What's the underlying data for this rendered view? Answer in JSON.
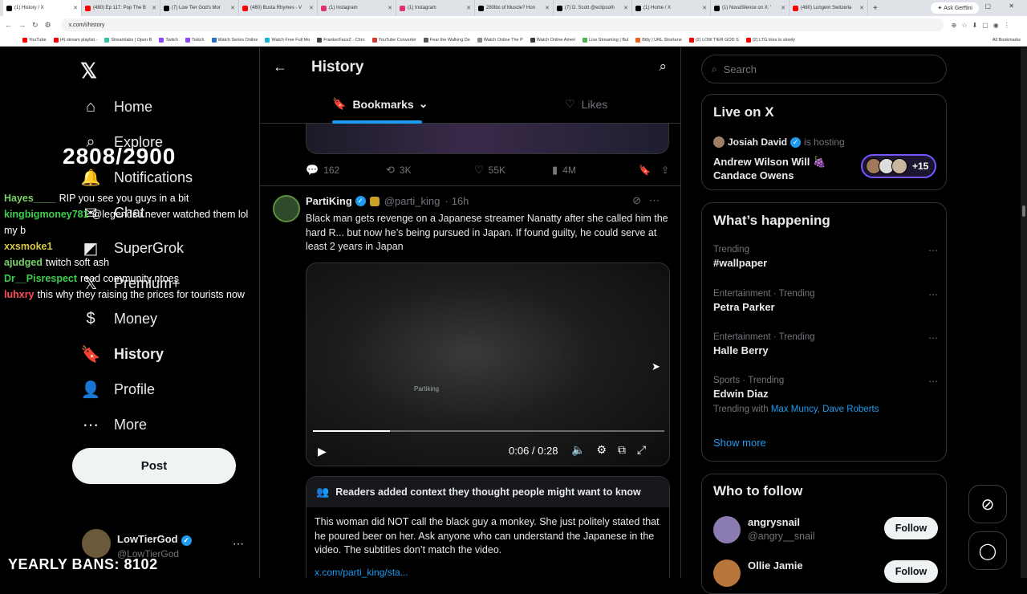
{
  "browser": {
    "tabs": [
      {
        "label": "(1) History / X",
        "color": "#000000",
        "active": true
      },
      {
        "label": "(480) Ep 117: Pop The B",
        "color": "#ff0000"
      },
      {
        "label": "(7) Low Tier God's Mor",
        "color": "#000000"
      },
      {
        "label": "(480) Busta Rhymes - V",
        "color": "#ff0000"
      },
      {
        "label": "(1) Instagram",
        "color": "#e1306c"
      },
      {
        "label": "(1) Instagram",
        "color": "#e1306c"
      },
      {
        "label": "280lbs of Muscle? Hon",
        "color": "#000000"
      },
      {
        "label": "(7) D. Scott @eclipsoth",
        "color": "#000000"
      },
      {
        "label": "(1) Home / X",
        "color": "#000000"
      },
      {
        "label": "(1) NovaSilence on X: '",
        "color": "#000000"
      },
      {
        "label": "(480) Lungem Switzerla",
        "color": "#ff0000"
      }
    ],
    "ask_gemini": "Ask Gemini",
    "url": "x.com/i/history",
    "bookmarks": [
      {
        "label": "YouTube",
        "color": "#ff0000"
      },
      {
        "label": "(4) stream playlist -",
        "color": "#ff0000"
      },
      {
        "label": "Streamlabs | Open B",
        "color": "#31c3a2"
      },
      {
        "label": "Twitch",
        "color": "#9146ff"
      },
      {
        "label": "Twitch",
        "color": "#9146ff"
      },
      {
        "label": "Watch Series Online",
        "color": "#2a6ebb"
      },
      {
        "label": "Watch Free Full Mo",
        "color": "#19b5d1"
      },
      {
        "label": "FrankerFaceZ - Chro",
        "color": "#444444"
      },
      {
        "label": "YouTube Converter",
        "color": "#d23a3a"
      },
      {
        "label": "Fear the Walking De",
        "color": "#5a5a5a"
      },
      {
        "label": "Watch Online The P",
        "color": "#888888"
      },
      {
        "label": "Watch Online Ameri",
        "color": "#3a3a3a"
      },
      {
        "label": "Live Streaming | Bul",
        "color": "#4caf50"
      },
      {
        "label": "Bitly | URL Shortene",
        "color": "#ee6123"
      },
      {
        "label": "(2) LOW TIER GOD S",
        "color": "#ff0000"
      },
      {
        "label": "(2) LTG tries to slowly",
        "color": "#ff0000"
      }
    ],
    "all_bookmarks": "All Bookmarks"
  },
  "nav": {
    "items": [
      {
        "label": "Home",
        "icon": "home-icon",
        "glyph": "⌂"
      },
      {
        "label": "Explore",
        "icon": "search-icon",
        "glyph": "⌕"
      },
      {
        "label": "Notifications",
        "icon": "bell-icon",
        "glyph": "🔔"
      },
      {
        "label": "Chat",
        "icon": "mail-icon",
        "glyph": "✉"
      },
      {
        "label": "SuperGrok",
        "icon": "grok-icon",
        "glyph": "◩"
      },
      {
        "label": "Premium+",
        "icon": "x-premium-icon",
        "glyph": "𝕏"
      },
      {
        "label": "Money",
        "icon": "money-icon",
        "glyph": "$"
      },
      {
        "label": "History",
        "icon": "bookmark-icon",
        "glyph": "🔖"
      },
      {
        "label": "Profile",
        "icon": "profile-icon",
        "glyph": "👤"
      },
      {
        "label": "More",
        "icon": "more-icon",
        "glyph": "⋯"
      }
    ],
    "notif_badge": "1",
    "post_label": "Post",
    "user_name": "LowTierGod",
    "user_handle": "@LowTierGod"
  },
  "overlay": {
    "counter": "2808/2900",
    "bans": "YEARLY BANS: 8102",
    "chat": [
      {
        "user": "Hayes____",
        "user_color": "#7bd16a",
        "msg": "RIP you see you guys in a bit"
      },
      {
        "user": "kingbigmoney781",
        "user_color": "#3ecf4f",
        "msg": "@legends i never watched them lol my b"
      },
      {
        "user": "xxsmoke1",
        "user_color": "#d8c84a",
        "msg": ""
      },
      {
        "user": "ajudged",
        "user_color": "#7ad36a",
        "msg": "twitch soft ash"
      },
      {
        "user": "Dr__Pisrespect",
        "user_color": "#3ecf4f",
        "msg": "read community ntoes"
      },
      {
        "user": "luhxry",
        "user_color": "#ff4e5b",
        "msg": "this why they raising the prices for tourists now"
      }
    ]
  },
  "main": {
    "title": "History",
    "tabs": [
      {
        "label": "Bookmarks"
      },
      {
        "label": "Likes"
      }
    ],
    "prev_actions": {
      "replies": "162",
      "reposts": "3K",
      "likes": "55K",
      "views": "4M"
    },
    "tweet": {
      "name": "PartiKing",
      "handle": "@parti_king",
      "time": "16h",
      "text": "Black man gets revenge on a Japanese streamer Nanatty after she called him the hard R... but now he’s being pursued in Japan. If found guilty, he could serve at least 2 years in Japan",
      "video_watermark": "Partiking",
      "video_time": "0:06 / 0:28",
      "video_progress": 0.22
    },
    "notes": {
      "heading": "Readers added context they thought people might want to know",
      "body": "This woman did NOT call the black guy a monkey. She just politely stated that he poured beer on her. Ask anyone who can understand the Japanese in the video. The subtitles don’t match the video.",
      "link": "x.com/parti_king/sta..."
    }
  },
  "sidebar": {
    "search_placeholder": "Search",
    "live": {
      "title": "Live on X",
      "host_name": "Josiah David",
      "host_suffix": "is hosting",
      "space_title": "Andrew Wilson Will 🍇 Candace Owens",
      "plus": "+15"
    },
    "happening": {
      "title": "What’s happening",
      "trends": [
        {
          "category": "Trending",
          "name": "#wallpaper",
          "with": []
        },
        {
          "category": "Entertainment · Trending",
          "name": "Petra Parker",
          "with": []
        },
        {
          "category": "Entertainment · Trending",
          "name": "Halle Berry",
          "with": []
        },
        {
          "category": "Sports · Trending",
          "name": "Edwin Diaz",
          "with_label": "Trending with",
          "with": [
            "Max Muncy",
            "Dave Roberts"
          ]
        }
      ],
      "show_more": "Show more"
    },
    "who_to_follow": {
      "title": "Who to follow",
      "users": [
        {
          "name": "angrysnail",
          "handle": "@angry__snail",
          "follow": "Follow",
          "color": "#8a7bb0"
        },
        {
          "name": "Ollie Jamie",
          "handle": "",
          "follow": "Follow",
          "color": "#b8763a"
        }
      ]
    }
  }
}
